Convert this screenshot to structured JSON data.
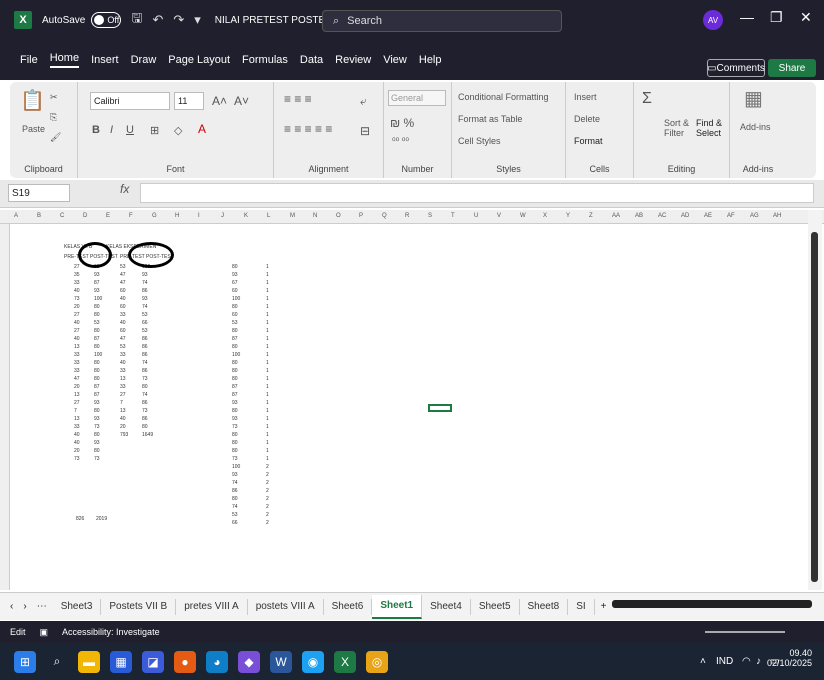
{
  "titlebar": {
    "app_icon": "X",
    "autosave_label": "AutoSave",
    "toggle_state": "Off",
    "doc_title": "NILAI PRETEST POSTETES H... ∨",
    "search_placeholder": "Search",
    "avatar": "AV"
  },
  "menu": [
    "File",
    "Home",
    "Insert",
    "Draw",
    "Page Layout",
    "Formulas",
    "Data",
    "Review",
    "View",
    "Help"
  ],
  "menu_active": "Home",
  "comments_label": "Comments",
  "share_label": "Share",
  "ribbon": {
    "groups": [
      "Clipboard",
      "Font",
      "Alignment",
      "Number",
      "Styles",
      "Cells",
      "Editing",
      "Add-ins"
    ],
    "paste": "Paste",
    "font_name": "Calibri",
    "font_size": "11",
    "number_format": "General",
    "conditional_formatting": "Conditional Formatting",
    "format_as_table": "Format as Table",
    "cell_styles": "Cell Styles",
    "insert": "Insert",
    "delete": "Delete",
    "format": "Format",
    "sort_filter": "Sort & Filter",
    "find_select": "Find & Select",
    "addins": "Add-ins"
  },
  "formula_bar": {
    "name_box": "S19",
    "fx": "fx",
    "content": ""
  },
  "columns": [
    "A",
    "B",
    "C",
    "D",
    "E",
    "F",
    "G",
    "H",
    "I",
    "J",
    "K",
    "L",
    "M",
    "N",
    "O",
    "P",
    "Q",
    "R",
    "S",
    "T",
    "U",
    "V",
    "W",
    "X",
    "Y",
    "Z",
    "AA",
    "AB",
    "AC",
    "AD",
    "AE",
    "AF",
    "AG",
    "AH"
  ],
  "sheet": {
    "header1": "KELAS VII B",
    "header2": "KELAS EKSPERIMEN",
    "sub1": "PRE-TEST",
    "sub2": "POST-TEST",
    "sub3": "PRE-TEST",
    "sub4": "POST-TEST",
    "col_c": [
      "27",
      "35",
      "33",
      "40",
      "73",
      "20",
      "27",
      "40",
      "27",
      "40",
      "13",
      "33",
      "33",
      "33",
      "47",
      "20",
      "13",
      "27",
      "7",
      "13",
      "33",
      "40",
      "40",
      "20",
      "73"
    ],
    "col_d": [
      "93",
      "93",
      "87",
      "93",
      "100",
      "80",
      "80",
      "53",
      "80",
      "87",
      "80",
      "100",
      "80",
      "80",
      "80",
      "87",
      "87",
      "93",
      "80",
      "93",
      "73",
      "80",
      "93",
      "80",
      "73"
    ],
    "col_e": [
      "53",
      "47",
      "47",
      "60",
      "40",
      "60",
      "33",
      "40",
      "60",
      "47",
      "53",
      "33",
      "40",
      "33",
      "13",
      "33",
      "27",
      "7",
      "13",
      "40",
      "20",
      "793"
    ],
    "col_f": [
      "100",
      "93",
      "74",
      "86",
      "93",
      "74",
      "53",
      "66",
      "53",
      "86",
      "86",
      "86",
      "74",
      "86",
      "73",
      "80",
      "74",
      "86",
      "73",
      "86",
      "80",
      "1649"
    ],
    "sum_c": "826",
    "sum_d": "2019",
    "col_j": [
      "80",
      "93",
      "67",
      "60",
      "100",
      "80",
      "60",
      "53",
      "80",
      "87",
      "80",
      "100",
      "80",
      "80",
      "80",
      "87",
      "87",
      "93",
      "80",
      "93",
      "73",
      "80",
      "80",
      "80",
      "73",
      "100",
      "93",
      "74",
      "86",
      "80",
      "74",
      "53",
      "66"
    ],
    "col_k": [
      "1",
      "1",
      "1",
      "1",
      "1",
      "1",
      "1",
      "1",
      "1",
      "1",
      "1",
      "1",
      "1",
      "1",
      "1",
      "1",
      "1",
      "1",
      "1",
      "1",
      "1",
      "1",
      "1",
      "1",
      "1",
      "2",
      "2",
      "2",
      "2",
      "2",
      "2",
      "2",
      "2"
    ]
  },
  "sheet_tabs": [
    "Sheet3",
    "Postets VII B",
    "pretes VIII A",
    "postets VIII A",
    "Sheet6",
    "Sheet1",
    "Sheet4",
    "Sheet5",
    "Sheet8",
    "SI"
  ],
  "active_tab": "Sheet1",
  "status": {
    "mode": "Edit",
    "accessibility": "Accessibility: Investigate"
  },
  "tray": {
    "lang": "IND",
    "time": "09.40",
    "date": "02/10/2025"
  }
}
